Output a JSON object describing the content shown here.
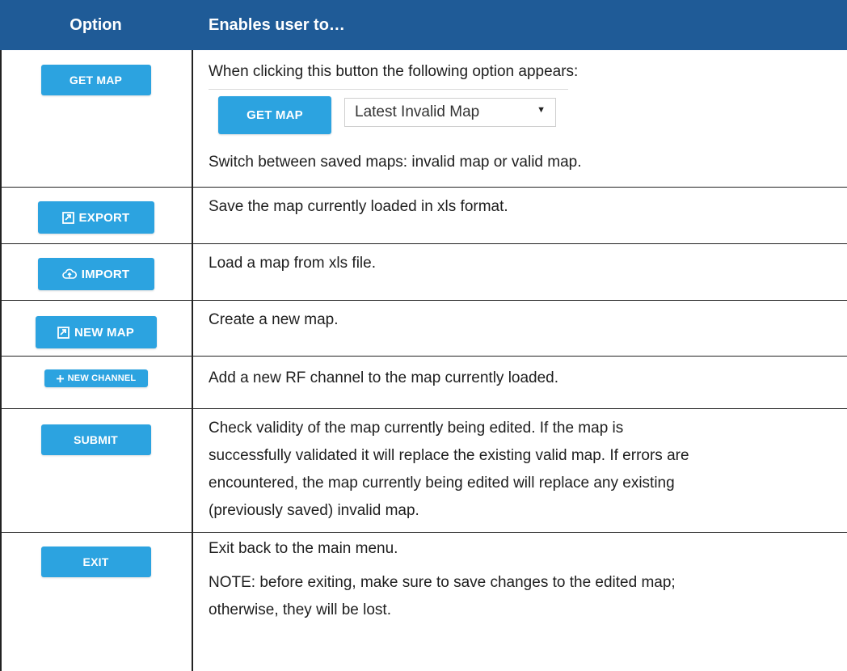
{
  "header": {
    "option_col": "Option",
    "desc_col": "Enables user to…"
  },
  "rows": [
    {
      "button_label": "GET MAP",
      "desc_lines": [
        "When clicking this button the following option appears:",
        "Switch between saved maps: invalid map or valid map."
      ],
      "inline_example": {
        "button_label": "GET MAP",
        "select_value": "Latest Invalid Map"
      }
    },
    {
      "button_label": "EXPORT",
      "icon": "export-icon",
      "desc_lines": [
        "Save the map currently loaded in xls format."
      ]
    },
    {
      "button_label": "IMPORT",
      "icon": "cloud-upload-icon",
      "desc_lines": [
        "Load a map from xls file."
      ]
    },
    {
      "button_label": "NEW MAP",
      "icon": "new-map-icon",
      "desc_lines": [
        "Create a new map."
      ]
    },
    {
      "button_label": "NEW CHANNEL",
      "icon": "plus-icon",
      "desc_lines": [
        "Add a new RF channel to the map currently loaded."
      ]
    },
    {
      "button_label": "SUBMIT",
      "desc_lines": [
        "Check validity of the map currently being edited. If the map is",
        "successfully validated it will replace the existing valid map. If errors are",
        "encountered, the map currently being edited will replace any existing",
        "(previously saved) invalid map."
      ]
    },
    {
      "button_label": "EXIT",
      "desc_lines": [
        "Exit back to the main menu.",
        "NOTE: before exiting, make sure to save changes to the edited map;",
        "otherwise, they will be lost."
      ]
    }
  ],
  "colors": {
    "header_bg": "#1f5b97",
    "button_bg": "#2ca3e0"
  }
}
